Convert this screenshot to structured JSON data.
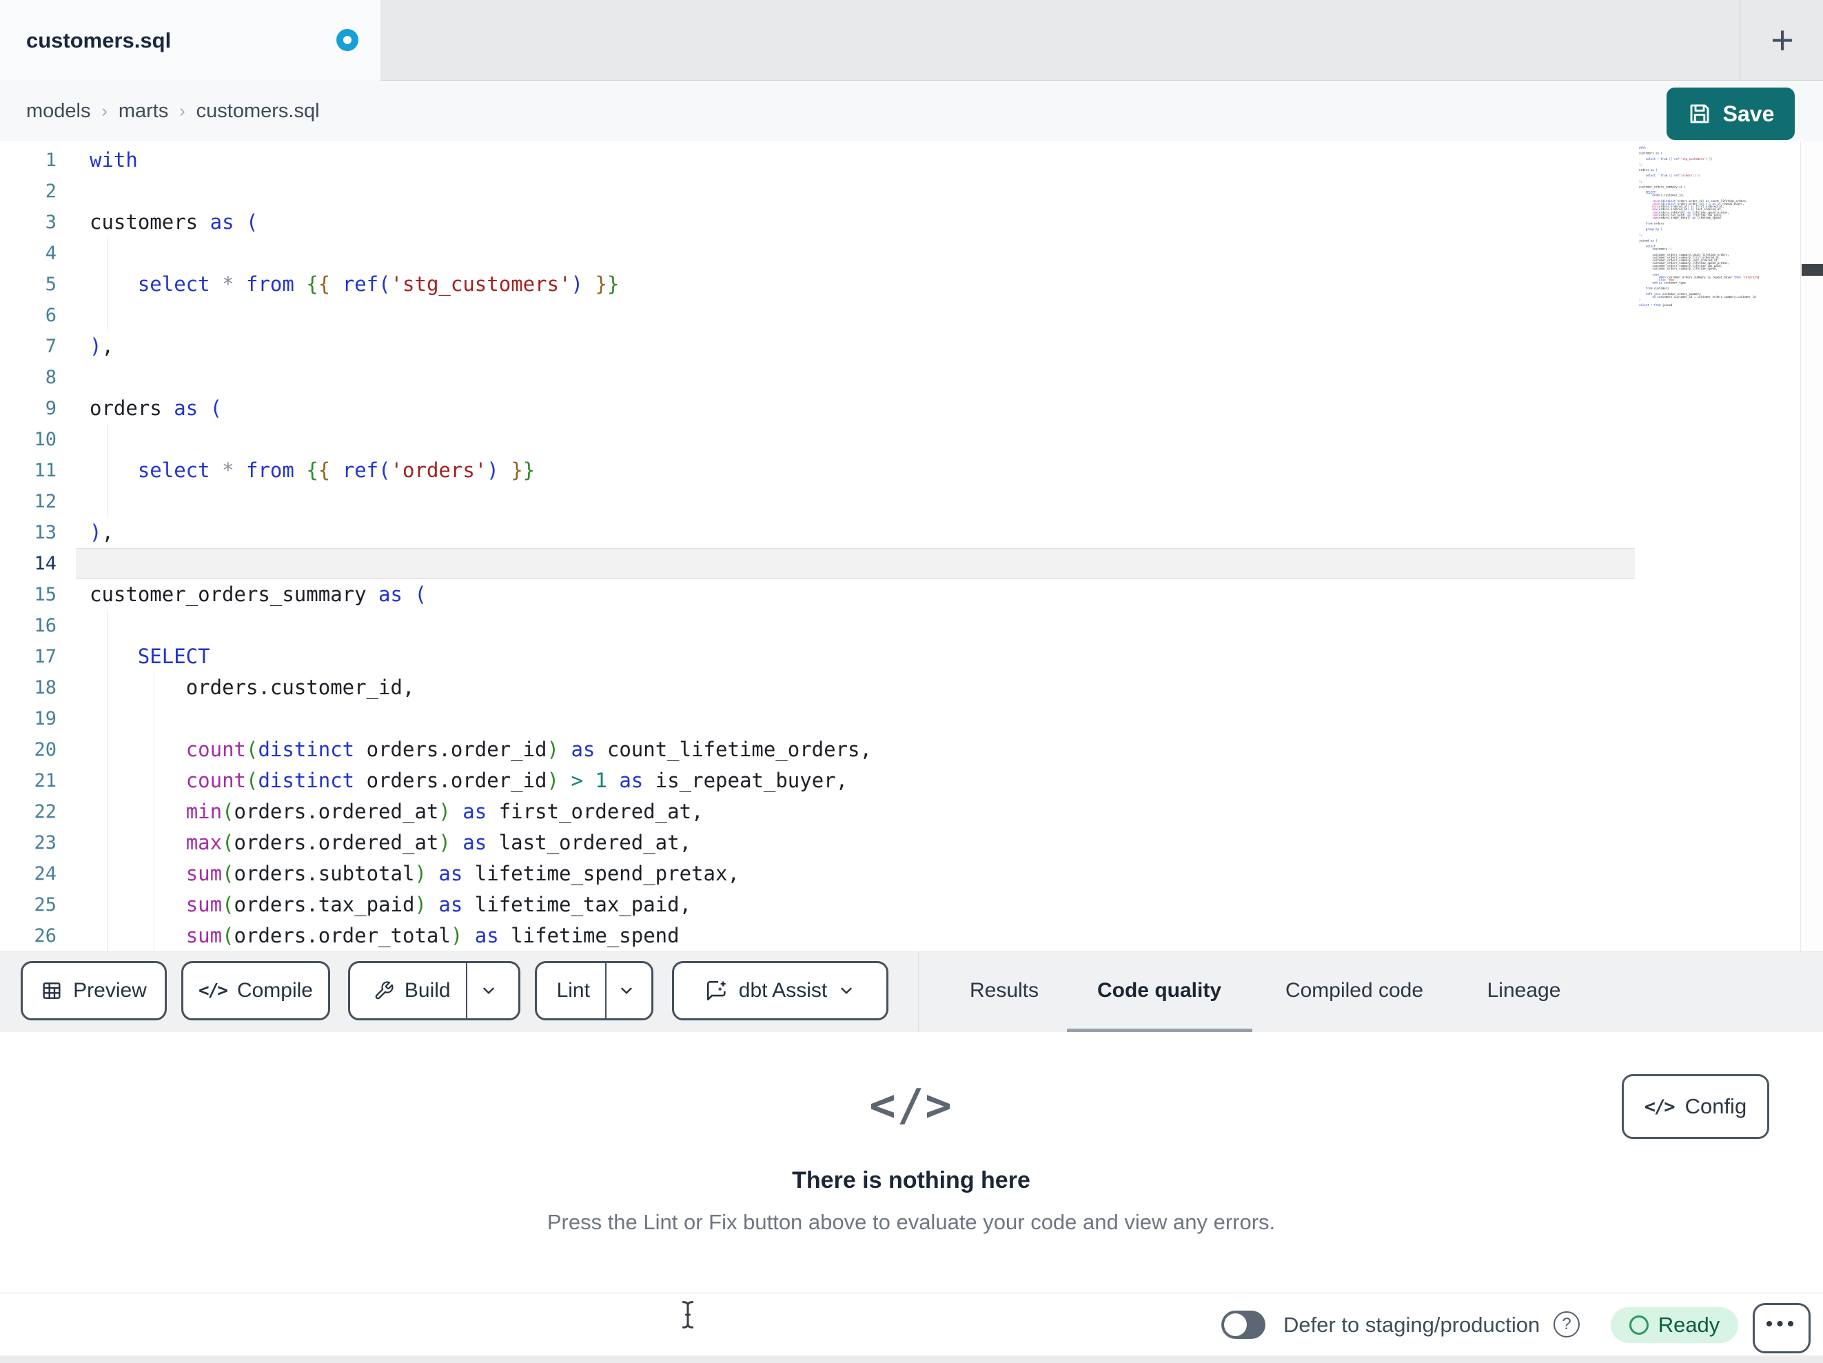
{
  "tab_bar": {
    "active_tab": "customers.sql",
    "modified": true,
    "new_tab_button": "+"
  },
  "breadcrumb": {
    "items": [
      "models",
      "marts",
      "customers.sql"
    ],
    "separator": "›"
  },
  "save_button": {
    "label": "Save"
  },
  "editor": {
    "language": "sql-jinja",
    "active_line": 14,
    "visible_line_count": 26,
    "file_lines": [
      "with",
      "",
      "customers as (",
      "",
      "    select * from {{ ref('stg_customers') }}",
      "",
      "),",
      "",
      "orders as (",
      "",
      "    select * from {{ ref('orders') }}",
      "",
      "),",
      "",
      "customer_orders_summary as (",
      "",
      "    SELECT",
      "        orders.customer_id,",
      "",
      "        count(distinct orders.order_id) as count_lifetime_orders,",
      "        count(distinct orders.order_id) > 1 as is_repeat_buyer,",
      "        min(orders.ordered_at) as first_ordered_at,",
      "        max(orders.ordered_at) as last_ordered_at,",
      "        sum(orders.subtotal) as lifetime_spend_pretax,",
      "        sum(orders.tax_paid) as lifetime_tax_paid,",
      "        sum(orders.order_total) as lifetime_spend",
      "",
      "    from orders",
      "",
      "    group by 1",
      "",
      "),",
      "",
      "joined as (",
      "",
      "    select",
      "        customers.*,",
      "",
      "        customer_orders_summary.count_lifetime_orders,",
      "        customer_orders_summary.first_ordered_at,",
      "        customer_orders_summary.last_ordered_at,",
      "        customer_orders_summary.lifetime_spend_pretax,",
      "        customer_orders_summary.lifetime_tax_paid,",
      "        customer_orders_summary.lifetime_spend,",
      "",
      "        case",
      "            when customer_orders_summary.is_repeat_buyer then 'returning'",
      "            else 'new'",
      "        end as customer_type",
      "",
      "    from customers",
      "",
      "    left join customer_orders_summary",
      "        on customers.customer_id = customer_orders_summary.customer_id",
      ")",
      "",
      "select * from joined"
    ]
  },
  "toolbar": {
    "preview": {
      "label": "Preview"
    },
    "compile": {
      "label": "Compile",
      "icon_text": "</>"
    },
    "build": {
      "label": "Build"
    },
    "lint": {
      "label": "Lint"
    },
    "assist": {
      "label": "dbt Assist"
    }
  },
  "panel_tabs": [
    {
      "label": "Results",
      "active": false
    },
    {
      "label": "Code quality",
      "active": true
    },
    {
      "label": "Compiled code",
      "active": false
    },
    {
      "label": "Lineage",
      "active": false
    }
  ],
  "empty_state": {
    "icon_text": "</>",
    "title": "There is nothing here",
    "message": "Press the Lint or Fix button above to evaluate your code and view any errors."
  },
  "config_button": {
    "icon_text": "</>",
    "label": "Config"
  },
  "status_bar": {
    "defer_toggle_on": false,
    "defer_label": "Defer to staging/production",
    "help_glyph": "?",
    "ready_label": "Ready",
    "more_glyph": "•••"
  },
  "colors": {
    "accent_teal": "#116e70",
    "modified_dot_blue": "#189fd8",
    "ready_bg": "#d8f4e4",
    "ready_text": "#0e5c3b",
    "tab_underline": "#9aa0a8",
    "syntax": {
      "keyword": "#2134cf",
      "function": "#a52ea5",
      "string": "#a32020",
      "number": "#17807a",
      "operator": "#17807a",
      "star": "#8a909a",
      "identifier": "#1c2026",
      "bracket1": "#2134cf",
      "bracket2": "#2f8a26",
      "bracket3": "#96611d",
      "line_number": "#44809a",
      "active_line_number": "#1c3566"
    }
  }
}
